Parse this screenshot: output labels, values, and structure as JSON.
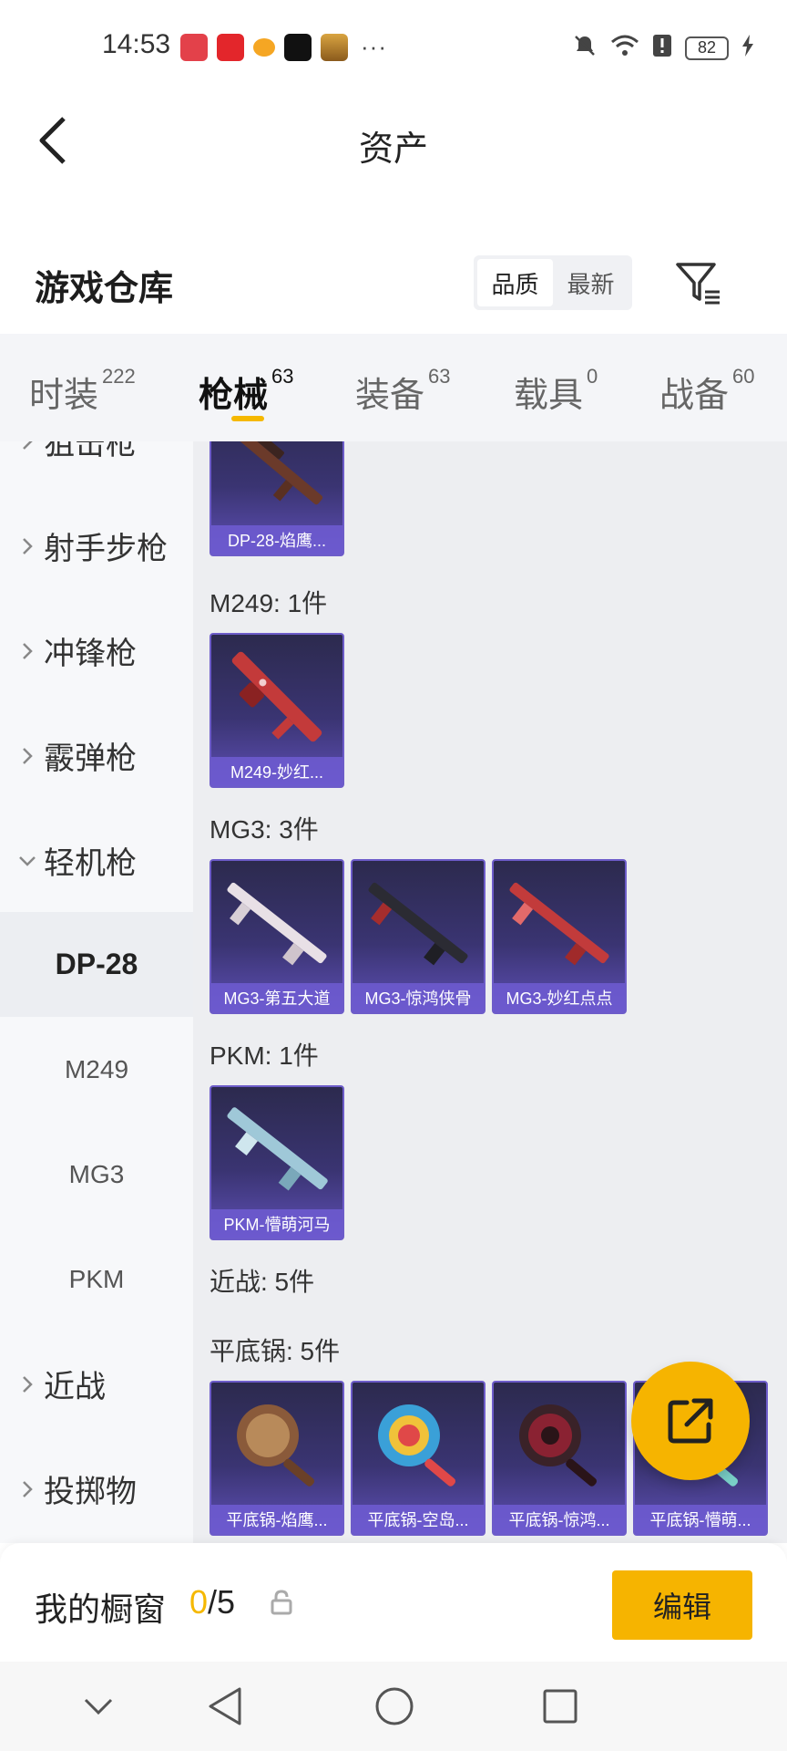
{
  "status_bar": {
    "time": "14:53",
    "more": "···",
    "battery": "82",
    "icons": [
      "huawei-app-icon",
      "netease-music-icon",
      "game-app-icon",
      "tiktok-icon",
      "game-banner-icon",
      "mute-icon",
      "wifi-icon",
      "alert-icon",
      "charging-icon"
    ]
  },
  "header": {
    "title": "资产",
    "back_icon": "chevron-left-icon"
  },
  "warehouse": {
    "title": "游戏仓库",
    "sort_options": [
      "品质",
      "最新"
    ],
    "active_sort": "品质",
    "filter_icon": "filter-icon"
  },
  "tabs": [
    {
      "label": "时装",
      "count": "222"
    },
    {
      "label": "枪械",
      "count": "63",
      "active": true
    },
    {
      "label": "装备",
      "count": "63"
    },
    {
      "label": "载具",
      "count": "0"
    },
    {
      "label": "战备",
      "count": "60"
    }
  ],
  "sidenav": {
    "partial_top": "狙击枪",
    "items": [
      {
        "label": "射手步枪",
        "expanded": false
      },
      {
        "label": "冲锋枪",
        "expanded": false
      },
      {
        "label": "霰弹枪",
        "expanded": false
      },
      {
        "label": "轻机枪",
        "expanded": true
      }
    ],
    "subitems": [
      {
        "label": "DP-28",
        "active": true
      },
      {
        "label": "M249"
      },
      {
        "label": "MG3"
      },
      {
        "label": "PKM"
      }
    ],
    "after": [
      {
        "label": "近战"
      },
      {
        "label": "投掷物"
      }
    ]
  },
  "groups": {
    "dp28": {
      "cards": [
        "DP-28-焰鹰..."
      ]
    },
    "m249": {
      "label": "M249: 1件",
      "cards": [
        "M249-妙红..."
      ]
    },
    "mg3": {
      "label": "MG3: 3件",
      "cards": [
        "MG3-第五大道",
        "MG3-惊鸿侠骨",
        "MG3-妙红点点"
      ]
    },
    "pkm": {
      "label": "PKM: 1件",
      "cards": [
        "PKM-懵萌河马"
      ]
    },
    "melee": {
      "label": "近战: 5件"
    },
    "pan": {
      "label": "平底锅: 5件",
      "cards": [
        "平底锅-焰鹰...",
        "平底锅-空岛...",
        "平底锅-惊鸿...",
        "平底锅-懵萌..."
      ]
    }
  },
  "fab": {
    "icon": "share-external-icon"
  },
  "showcase": {
    "title": "我的橱窗",
    "current": "0",
    "separator_total": "/5",
    "lock_icon": "lock-icon",
    "edit_label": "编辑"
  },
  "colors": {
    "accent": "#f6b400",
    "card_bg": "#3a3472",
    "card_caption": "#6e5cd2"
  }
}
